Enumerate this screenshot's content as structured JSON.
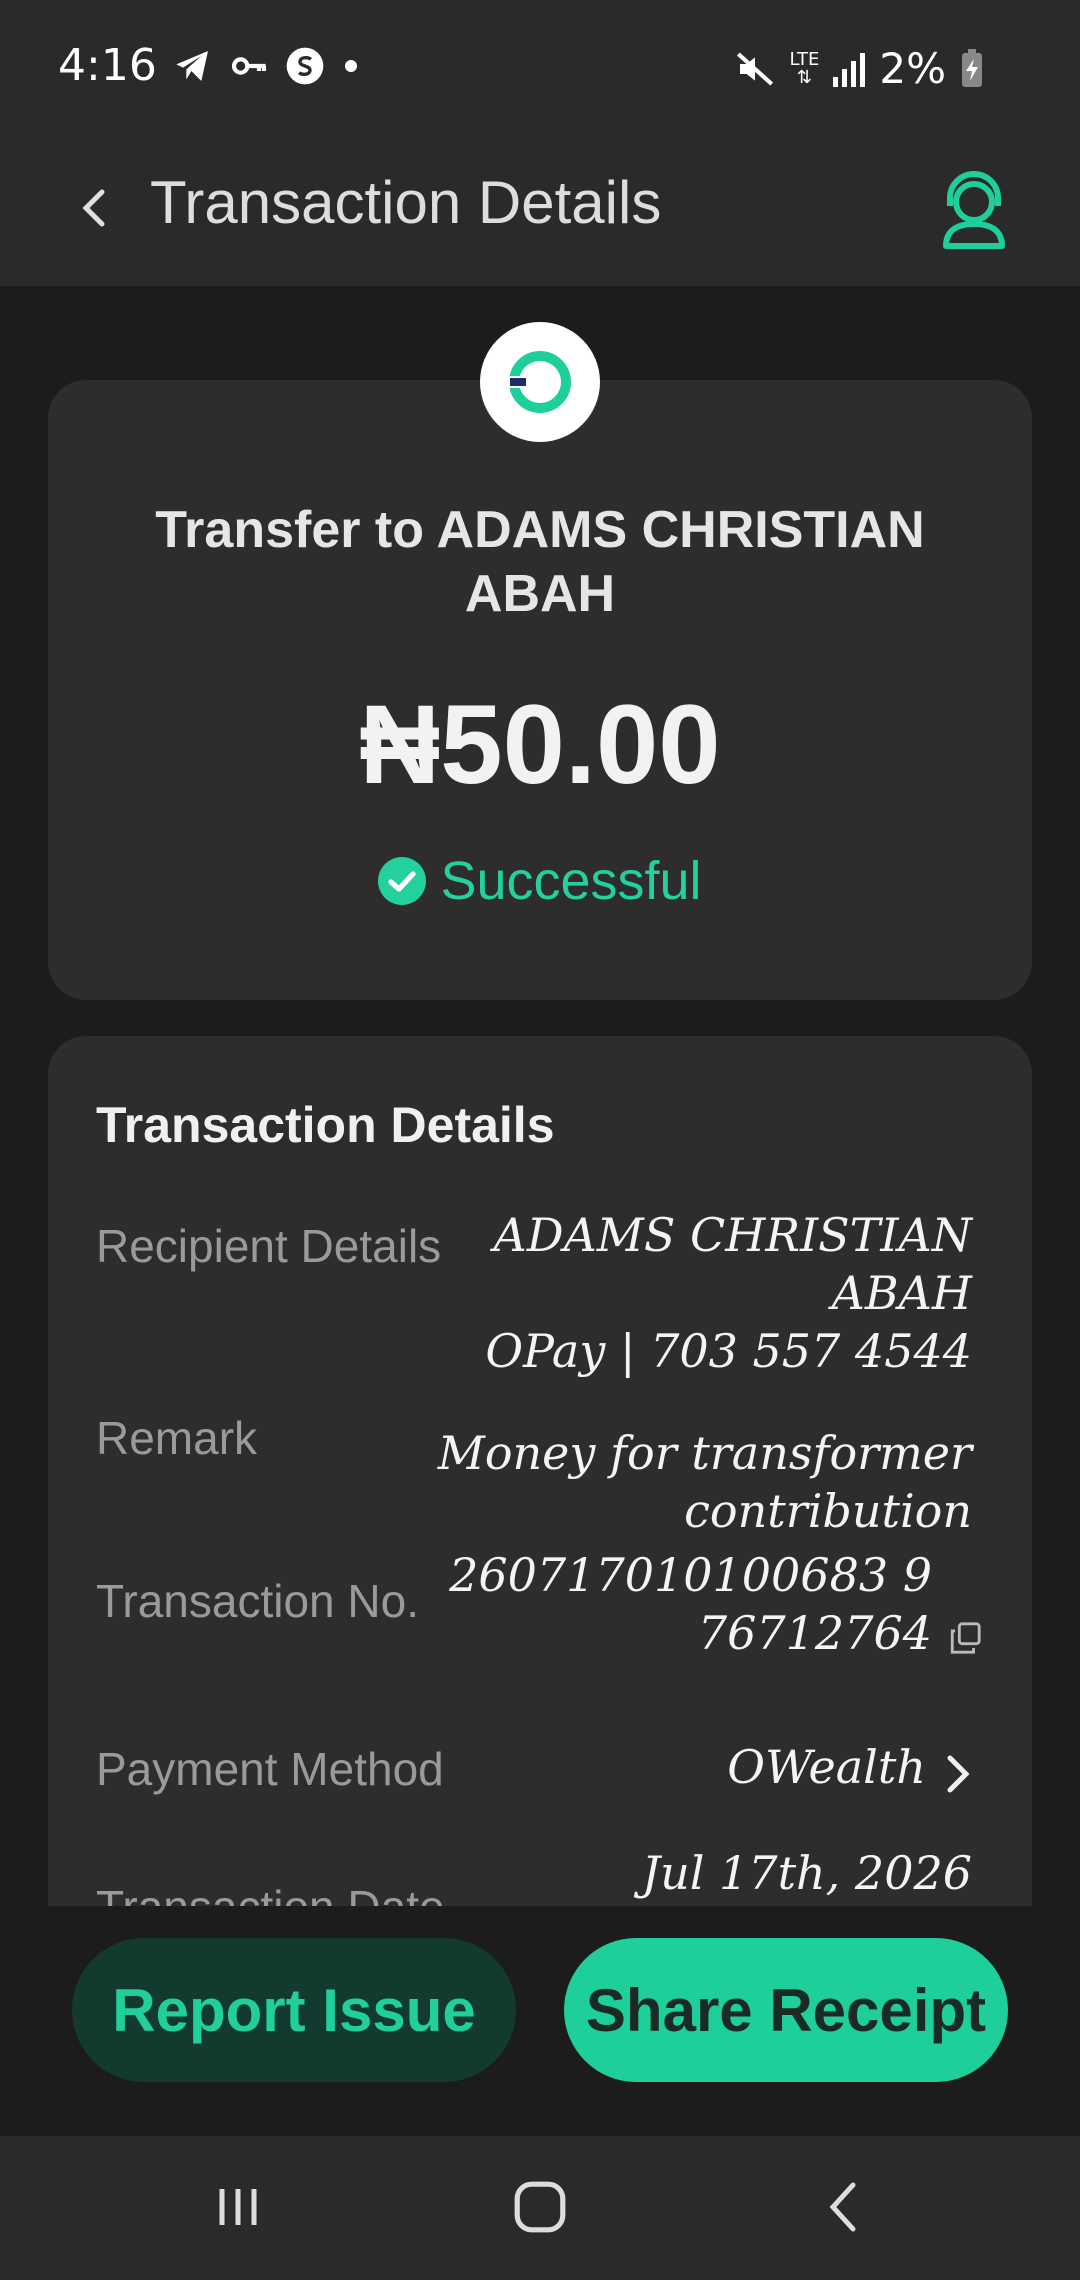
{
  "status_bar": {
    "time": "4:16",
    "network": "LTE",
    "battery": "2%"
  },
  "header": {
    "title": "Transaction Details",
    "back_icon": "chevron-left-icon",
    "support_icon": "headset-agent-icon"
  },
  "summary": {
    "recipient_heading": "Transfer to ADAMS CHRISTIAN ABAH",
    "amount": "₦50.00",
    "status": "Successful",
    "status_color": "#24d09d"
  },
  "details": {
    "title": "Transaction Details",
    "recipient_label": "Recipient Details",
    "recipient_name_line1": "ADAMS CHRISTIAN",
    "recipient_name_line2": "ABAH",
    "recipient_account": "OPay | 703 557 4544",
    "remark_label": "Remark",
    "remark_line1": "Money for transformer",
    "remark_line2": "contribution",
    "transaction_no_label": "Transaction No.",
    "transaction_no_line1": "260717010100683 9",
    "transaction_no_line2": "76712764",
    "payment_method_label": "Payment Method",
    "payment_method_value": "OWealth",
    "transaction_date_label": "Transaction Date",
    "transaction_date_value": "Jul 17th, 2026"
  },
  "actions": {
    "report_label": "Report Issue",
    "share_label": "Share Receipt"
  },
  "colors": {
    "accent": "#1ecf9b",
    "background": "#1c1c1c",
    "card": "#2d2d2d"
  }
}
